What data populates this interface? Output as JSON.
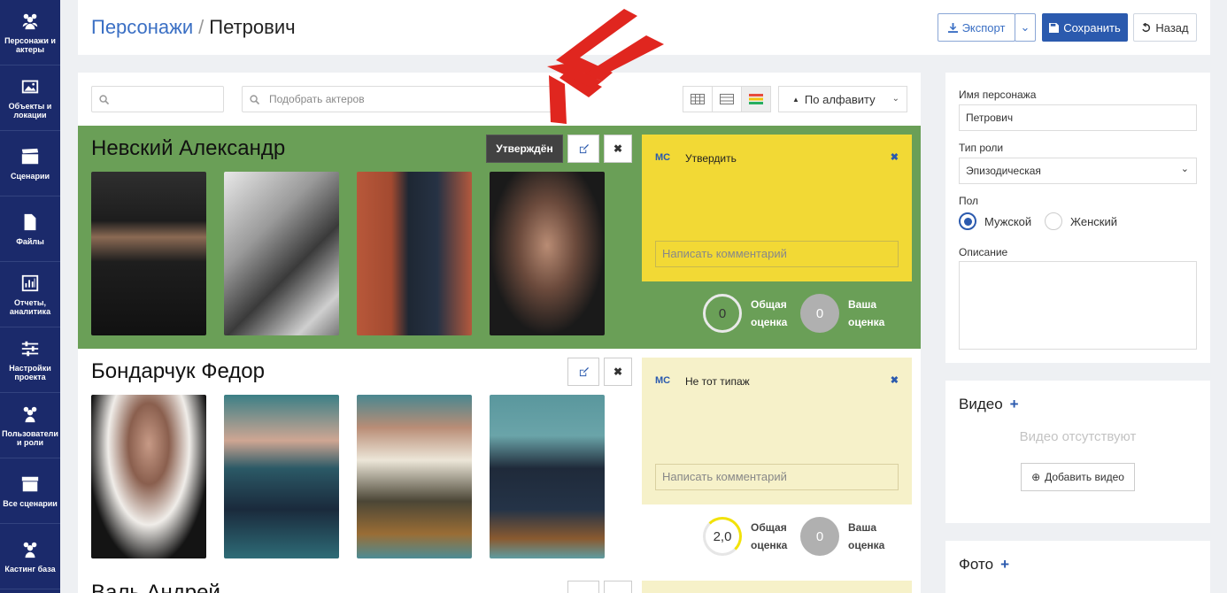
{
  "sidebar": {
    "items": [
      {
        "label": "Персонажи и актеры",
        "icon": "users-icon"
      },
      {
        "label": "Объекты и локации",
        "icon": "image-icon"
      },
      {
        "label": "Сценарии",
        "icon": "clapperboard-icon"
      },
      {
        "label": "Файлы",
        "icon": "file-icon"
      },
      {
        "label": "Отчеты, аналитика",
        "icon": "chart-icon"
      },
      {
        "label": "Настройки проекта",
        "icon": "sliders-icon"
      },
      {
        "label": "Пользователи и роли",
        "icon": "users-icon"
      },
      {
        "label": "Все сценарии",
        "icon": "archive-icon"
      },
      {
        "label": "Кастинг база",
        "icon": "users-icon"
      }
    ]
  },
  "header": {
    "breadcrumb_root": "Персонажи",
    "breadcrumb_sep": "/",
    "breadcrumb_current": "Петрович",
    "export_label": "Экспорт",
    "save_label": "Сохранить",
    "back_label": "Назад"
  },
  "toolbar": {
    "search_placeholder": "",
    "actor_search_placeholder": "Подобрать актеров",
    "sort_label": "По алфавиту"
  },
  "actors": [
    {
      "name": "Невский Александр",
      "status_label": "Утверждён",
      "comment_user": "MC",
      "comment_text": "Утвердить",
      "comment_placeholder": "Написать комментарий",
      "total_score": "0",
      "total_label_1": "Общая",
      "total_label_2": "оценка",
      "your_score": "0",
      "your_label_1": "Ваша",
      "your_label_2": "оценка"
    },
    {
      "name": "Бондарчук Федор",
      "comment_user": "MC",
      "comment_text": "Не тот типаж",
      "comment_placeholder": "Написать комментарий",
      "total_score": "2,0",
      "total_label_1": "Общая",
      "total_label_2": "оценка",
      "your_score": "0",
      "your_label_1": "Ваша",
      "your_label_2": "оценка"
    },
    {
      "name": "Валь Андрей"
    }
  ],
  "form": {
    "name_label": "Имя персонажа",
    "name_value": "Петрович",
    "role_label": "Тип роли",
    "role_value": "Эпизодическая",
    "gender_label": "Пол",
    "gender_male": "Мужской",
    "gender_female": "Женский",
    "desc_label": "Описание"
  },
  "video": {
    "title": "Видео",
    "empty_text": "Видео отсутствуют",
    "add_label": "Добавить видео"
  },
  "photo": {
    "title": "Фото"
  },
  "colors": {
    "sidebar": "#1b2a6b",
    "accent": "#2b5aae",
    "approved_row": "#6a9f57",
    "comment_yellow": "#f2d935",
    "comment_light": "#f6f1c9",
    "arrow": "#e0261f"
  }
}
